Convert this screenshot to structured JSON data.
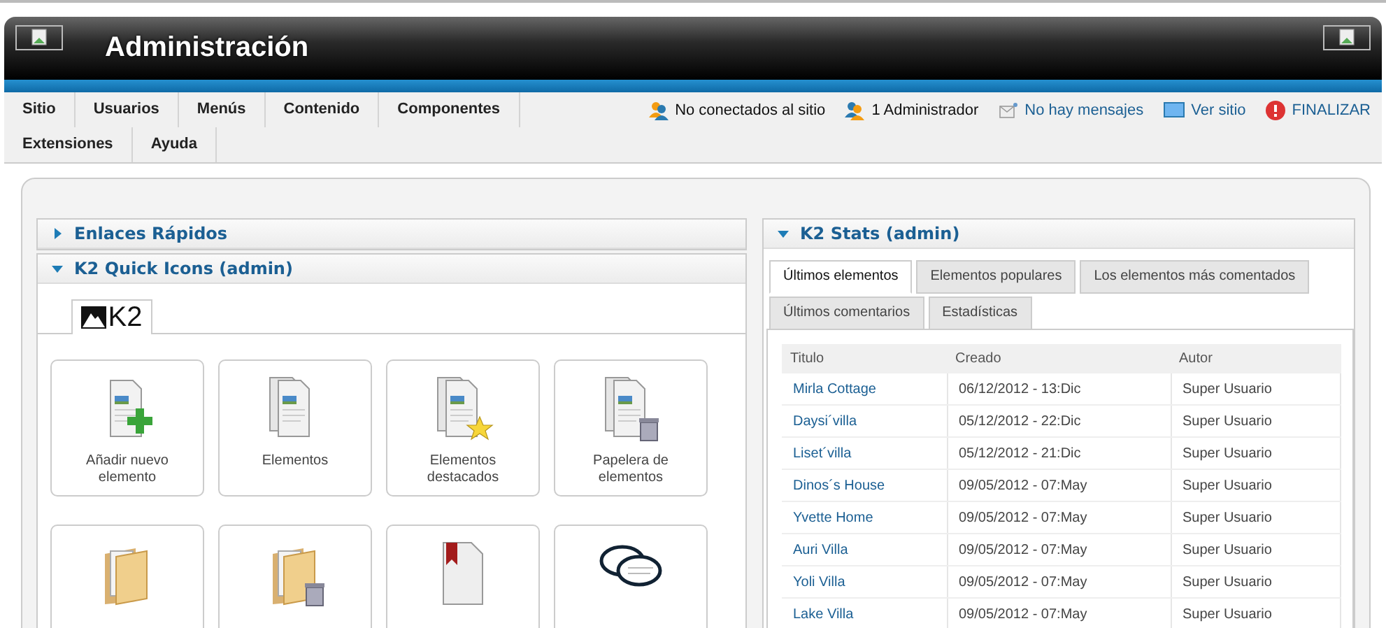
{
  "header": {
    "title": "Administración"
  },
  "menu_rows": [
    [
      {
        "label": "Sitio"
      },
      {
        "label": "Usuarios"
      },
      {
        "label": "Menús"
      },
      {
        "label": "Contenido"
      },
      {
        "label": "Componentes"
      }
    ],
    [
      {
        "label": "Extensiones"
      },
      {
        "label": "Ayuda"
      }
    ]
  ],
  "status": [
    {
      "kind": "users",
      "text": "No conectados al sitio"
    },
    {
      "kind": "admin",
      "text": "1 Administrador"
    },
    {
      "kind": "messages",
      "text": "No hay mensajes"
    },
    {
      "kind": "site",
      "text": "Ver sitio"
    },
    {
      "kind": "logout",
      "text": "FINALIZAR"
    }
  ],
  "left_modules": [
    {
      "title": "Enlaces Rápidos",
      "expanded": false
    },
    {
      "title": "K2 Quick Icons (admin)",
      "expanded": true
    }
  ],
  "k2_tab": {
    "label": "K2"
  },
  "quick_icons": [
    {
      "kind": "add",
      "label": "Añadir nuevo elemento"
    },
    {
      "kind": "items",
      "label": "Elementos"
    },
    {
      "kind": "featured",
      "label": "Elementos destacados"
    },
    {
      "kind": "trash",
      "label": "Papelera de elementos"
    },
    {
      "kind": "categories"
    },
    {
      "kind": "categories-trash"
    },
    {
      "kind": "tags"
    },
    {
      "kind": "comments"
    }
  ],
  "stats": {
    "title": "K2 Stats (admin)",
    "expanded": true,
    "tabs": [
      {
        "label": "Últimos elementos",
        "selected": true
      },
      {
        "label": "Elementos populares",
        "selected": false
      },
      {
        "label": "Los elementos más comentados",
        "selected": false
      },
      {
        "label": "Últimos comentarios",
        "selected": false
      },
      {
        "label": "Estadísticas",
        "selected": false
      }
    ],
    "columns": [
      "Titulo",
      "Creado",
      "Autor"
    ],
    "rows": [
      [
        "Mirla Cottage",
        "06/12/2012 - 13:Dic",
        "Super Usuario"
      ],
      [
        "Daysi´villa",
        "05/12/2012 - 22:Dic",
        "Super Usuario"
      ],
      [
        "Liset´villa",
        "05/12/2012 - 21:Dic",
        "Super Usuario"
      ],
      [
        "Dinos´s House",
        "09/05/2012 - 07:May",
        "Super Usuario"
      ],
      [
        "Yvette Home",
        "09/05/2012 - 07:May",
        "Super Usuario"
      ],
      [
        "Auri Villa",
        "09/05/2012 - 07:May",
        "Super Usuario"
      ],
      [
        "Yoli Villa",
        "09/05/2012 - 07:May",
        "Super Usuario"
      ],
      [
        "Lake Villa",
        "09/05/2012 - 07:May",
        "Super Usuario"
      ]
    ]
  }
}
